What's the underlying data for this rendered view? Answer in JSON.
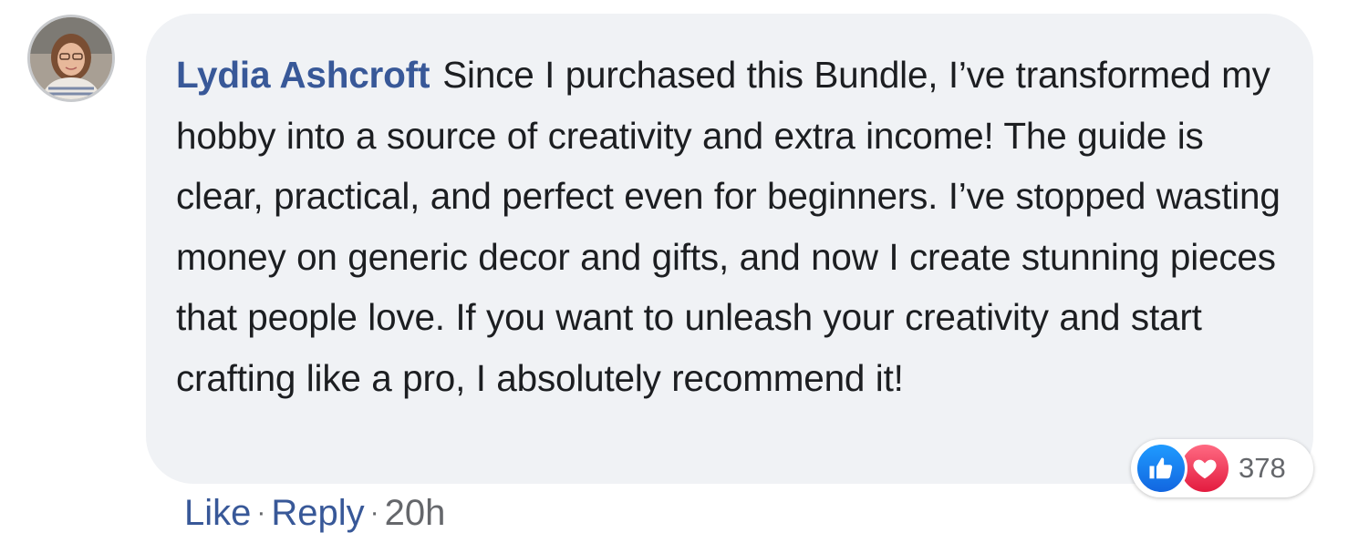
{
  "comment": {
    "author": "Lydia Ashcroft",
    "text": "Since I purchased this Bundle, I’ve transformed my hobby into a source of creativity and extra income! The guide is clear, practical, and perfect even for beginners. I’ve stopped wasting money on generic decor and gifts, and now I create stunning pieces that people love. If you want to unleash your creativity and start crafting like a pro, I absolutely recommend it!",
    "reactions": {
      "icons": [
        "like-icon",
        "love-icon"
      ],
      "count": "378"
    },
    "actions": {
      "like_label": "Like",
      "separator": "·",
      "reply_label": "Reply",
      "time": "20h"
    }
  },
  "colors": {
    "author_link": "#385898",
    "bubble_bg": "#f0f2f5",
    "text": "#1c1e21",
    "meta": "#65676b",
    "like_blue": "#1877f2",
    "love_red": "#f33e58"
  }
}
